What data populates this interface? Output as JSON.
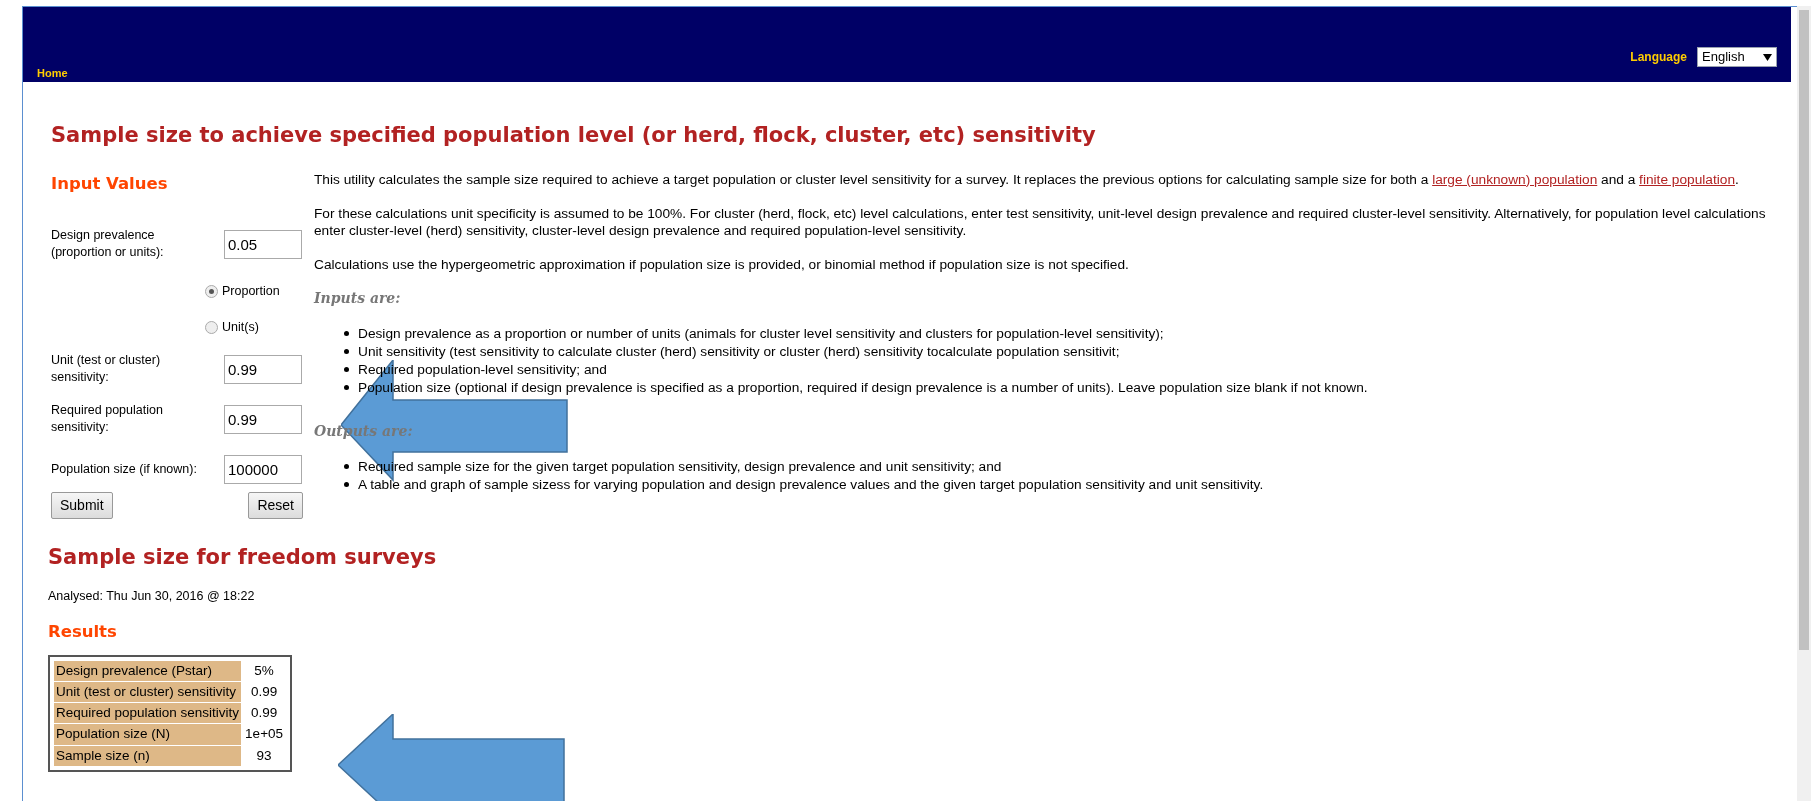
{
  "header": {
    "home_link": "Home",
    "language_label": "Language",
    "language_select": "English"
  },
  "title": "Sample size to achieve specified population level (or herd, flock, cluster, etc) sensitivity",
  "input_values": {
    "heading": "Input Values",
    "fields": [
      {
        "label": "Design prevalence (proportion or units):",
        "value": "0.05"
      },
      {
        "label": "Unit (test or cluster) sensitivity:",
        "value": "0.99"
      },
      {
        "label": "Required population sensitivity:",
        "value": "0.99"
      },
      {
        "label": "Population size (if known):",
        "value": "100000"
      }
    ],
    "prevalence_type": [
      {
        "label": "Proportion",
        "selected": true
      },
      {
        "label": "Unit(s)",
        "selected": false
      }
    ],
    "buttons": [
      "Submit",
      "Reset"
    ]
  },
  "description": {
    "paragraphs": [
      [
        {
          "kind": "text",
          "text": "This utility calculates the sample size required to achieve a target population or cluster level sensitivity for a survey. It replaces the previous options for calculating sample size for both a "
        },
        {
          "kind": "link",
          "text": "large (unknown) population"
        },
        {
          "kind": "text",
          "text": " and a "
        },
        {
          "kind": "link",
          "text": "finite population"
        },
        {
          "kind": "text",
          "text": "."
        }
      ],
      [
        {
          "kind": "text",
          "text": "For these calculations unit specificity is assumed to be 100%. For cluster (herd, flock, etc) level calculations, enter test sensitivity, unit-level design prevalence and required cluster-level sensitivity. Alternatively, for population level calculations enter cluster-level (herd) sensitivity, cluster-level design prevalence and required population-level sensitivity."
        }
      ],
      [
        {
          "kind": "text",
          "text": "Calculations use the hypergeometric approximation if population size is provided, or binomial method if population size is not specified."
        }
      ]
    ],
    "inputs_heading": "Inputs are:",
    "inputs": [
      "Design prevalence as a proportion or number of units (animals for cluster level sensitivity and clusters for population-level sensitivity);",
      "Unit sensitivity (test sensitivity to calculate cluster (herd) sensitivity or cluster (herd) sensitivity tocalculate population sensitivit;",
      "Required population-level sensitivity; and",
      "Population size (optional if design prevalence is specified as a proportion, required if design prevalence is a number of units). Leave population size blank if not known."
    ],
    "outputs_heading": "Outputs are:",
    "outputs": [
      "Required sample size for the given target population sensitivity, design prevalence and unit sensitivity; and",
      "A table and graph of sample sizess for varying population and design prevalence values and the given target population sensitivity and unit sensitivity."
    ]
  },
  "results": {
    "title": "Sample size for freedom surveys",
    "analysed": "Analysed: Thu Jun 30, 2016 @ 18:22",
    "heading": "Results",
    "rows": [
      {
        "label": "Design prevalence (Pstar)",
        "value": "5%"
      },
      {
        "label": "Unit (test or cluster) sensitivity",
        "value": "0.99"
      },
      {
        "label": "Required population sensitivity",
        "value": "0.99"
      },
      {
        "label": "Population size (N)",
        "value": "1e+05"
      },
      {
        "label": "Sample size (n)",
        "value": "93"
      }
    ]
  }
}
